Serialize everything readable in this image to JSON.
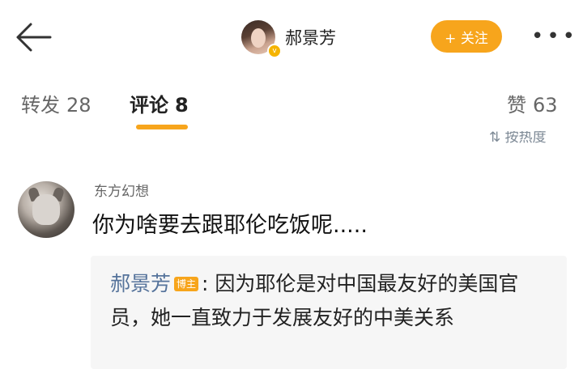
{
  "header": {
    "username": "郝景芳",
    "follow_label": "+ 关注",
    "more_label": "•••",
    "verified_mark": "v"
  },
  "tabs": [
    {
      "label": "转发",
      "count": "28"
    },
    {
      "label": "评论",
      "count": "8"
    },
    {
      "label": "赞",
      "count": "63"
    }
  ],
  "sort_label": "⇅ 按热度",
  "comment": {
    "author": "东方幻想",
    "text": "你为啥要去跟耶伦吃饭呢.....",
    "reply": {
      "author": "郝景芳",
      "badge": "博主",
      "separator": ":",
      "text": "因为耶伦是对中国最友好的美国官员，她一直致力于发展友好的中美关系"
    }
  },
  "colors": {
    "accent": "#f7a51c",
    "reply_name": "#55739b",
    "reply_bg": "#f6f6f6"
  }
}
